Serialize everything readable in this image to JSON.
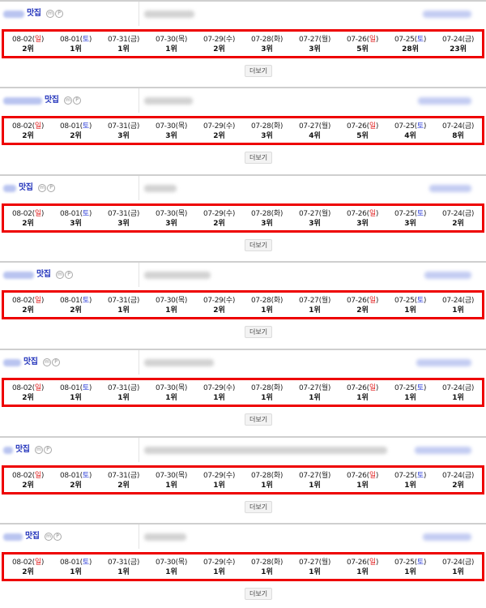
{
  "more_label": "더보기",
  "tag_label": "맛집",
  "circle_m": "m",
  "circle_p": "P",
  "colors": {
    "highlight_border": "#ee0000",
    "sunday": "#e02020",
    "saturday": "#2a3bd6"
  },
  "dates": [
    {
      "date": "08-02",
      "dow": "일",
      "kind": "sun"
    },
    {
      "date": "08-01",
      "dow": "토",
      "kind": "sat"
    },
    {
      "date": "07-31",
      "dow": "금",
      "kind": "wk"
    },
    {
      "date": "07-30",
      "dow": "목",
      "kind": "wk"
    },
    {
      "date": "07-29",
      "dow": "수",
      "kind": "wk"
    },
    {
      "date": "07-28",
      "dow": "화",
      "kind": "wk"
    },
    {
      "date": "07-27",
      "dow": "월",
      "kind": "wk"
    },
    {
      "date": "07-26",
      "dow": "일",
      "kind": "sun"
    },
    {
      "date": "07-25",
      "dow": "토",
      "kind": "sat"
    },
    {
      "date": "07-24",
      "dow": "금",
      "kind": "wk"
    }
  ],
  "blocks": [
    {
      "ranks": [
        "2위",
        "1위",
        "1위",
        "1위",
        "2위",
        "3위",
        "3위",
        "5위",
        "28위",
        "23위"
      ]
    },
    {
      "ranks": [
        "2위",
        "2위",
        "3위",
        "3위",
        "2위",
        "3위",
        "4위",
        "5위",
        "4위",
        "8위"
      ]
    },
    {
      "ranks": [
        "2위",
        "3위",
        "3위",
        "3위",
        "2위",
        "3위",
        "3위",
        "3위",
        "3위",
        "2위"
      ]
    },
    {
      "ranks": [
        "2위",
        "2위",
        "1위",
        "1위",
        "2위",
        "1위",
        "1위",
        "2위",
        "1위",
        "1위"
      ]
    },
    {
      "ranks": [
        "2위",
        "1위",
        "1위",
        "1위",
        "1위",
        "1위",
        "1위",
        "1위",
        "1위",
        "1위"
      ]
    },
    {
      "ranks": [
        "2위",
        "2위",
        "2위",
        "1위",
        "1위",
        "1위",
        "1위",
        "1위",
        "1위",
        "2위"
      ]
    },
    {
      "ranks": [
        "2위",
        "1위",
        "1위",
        "1위",
        "1위",
        "1위",
        "1위",
        "1위",
        "1위",
        "1위"
      ]
    }
  ]
}
